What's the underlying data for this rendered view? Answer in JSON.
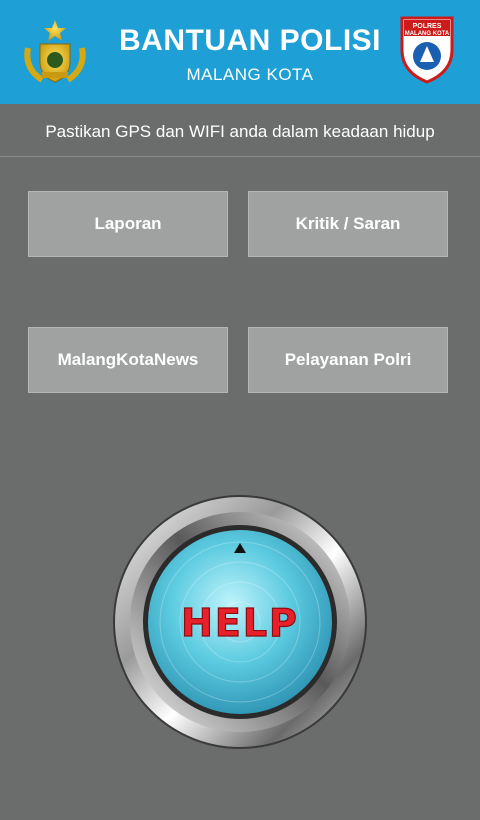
{
  "header": {
    "title": "BANTUAN POLISI",
    "subtitle": "MALANG KOTA",
    "right_badge_lines": [
      "POLRES",
      "MALANG KOTA"
    ],
    "background_color": "#1e9fd6"
  },
  "notice": "Pastikan GPS dan WIFI anda dalam keadaan hidup",
  "menu": [
    {
      "label": "Laporan"
    },
    {
      "label": "Kritik / Saran"
    },
    {
      "label": "MalangKotaNews"
    },
    {
      "label": "Pelayanan Polri"
    }
  ],
  "help_button": {
    "label": "HELP",
    "indicator": "up-triangle-icon",
    "text_color": "#e8202a"
  },
  "icons": {
    "left_logo": "police-emblem-icon",
    "right_logo": "polres-shield-icon"
  }
}
